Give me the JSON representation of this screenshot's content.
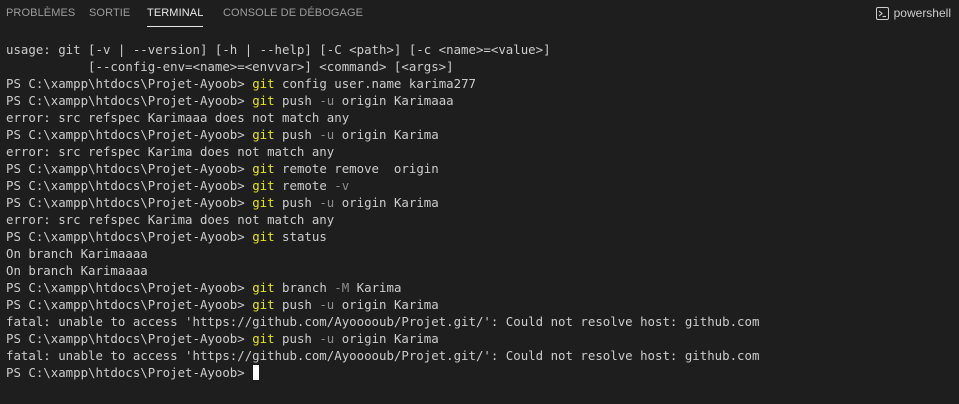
{
  "tabs": [
    {
      "label": "PROBLÈMES",
      "active": false
    },
    {
      "label": "SORTIE",
      "active": false
    },
    {
      "label": "TERMINAL",
      "active": true
    },
    {
      "label": "CONSOLE DE DÉBOGAGE",
      "active": false
    }
  ],
  "shell": {
    "label": "powershell",
    "icon": "terminal-powershell-icon"
  },
  "terminal": {
    "lines": [
      {
        "segments": [
          {
            "text": "usage: git [-v | --version] [-h | --help] [-C <path>] [-c <name>=<value>]",
            "style": "plain"
          }
        ]
      },
      {
        "segments": [
          {
            "text": "           [--config-env=<name>=<envvar>] <command> [<args>]",
            "style": "plain"
          }
        ]
      },
      {
        "segments": [
          {
            "text": "PS C:\\xampp\\htdocs\\Projet-Ayoob> ",
            "style": "plain"
          },
          {
            "text": "git",
            "style": "git"
          },
          {
            "text": " config user.name karima277",
            "style": "plain"
          }
        ]
      },
      {
        "segments": [
          {
            "text": "PS C:\\xampp\\htdocs\\Projet-Ayoob> ",
            "style": "plain"
          },
          {
            "text": "git",
            "style": "git"
          },
          {
            "text": " push ",
            "style": "plain"
          },
          {
            "text": "-u",
            "style": "dim"
          },
          {
            "text": " origin Karimaaa",
            "style": "plain"
          }
        ]
      },
      {
        "segments": [
          {
            "text": "error: src refspec Karimaaa does not match any",
            "style": "plain"
          }
        ]
      },
      {
        "segments": [
          {
            "text": "PS C:\\xampp\\htdocs\\Projet-Ayoob> ",
            "style": "plain"
          },
          {
            "text": "git",
            "style": "git"
          },
          {
            "text": " push ",
            "style": "plain"
          },
          {
            "text": "-u",
            "style": "dim"
          },
          {
            "text": " origin Karima",
            "style": "plain"
          }
        ]
      },
      {
        "segments": [
          {
            "text": "error: src refspec Karima does not match any",
            "style": "plain"
          }
        ]
      },
      {
        "segments": [
          {
            "text": "PS C:\\xampp\\htdocs\\Projet-Ayoob> ",
            "style": "plain"
          },
          {
            "text": "git",
            "style": "git"
          },
          {
            "text": " remote remove  origin",
            "style": "plain"
          }
        ]
      },
      {
        "segments": [
          {
            "text": "PS C:\\xampp\\htdocs\\Projet-Ayoob> ",
            "style": "plain"
          },
          {
            "text": "git",
            "style": "git"
          },
          {
            "text": " remote ",
            "style": "plain"
          },
          {
            "text": "-v",
            "style": "dim"
          }
        ]
      },
      {
        "segments": [
          {
            "text": "PS C:\\xampp\\htdocs\\Projet-Ayoob> ",
            "style": "plain"
          },
          {
            "text": "git",
            "style": "git"
          },
          {
            "text": " push ",
            "style": "plain"
          },
          {
            "text": "-u",
            "style": "dim"
          },
          {
            "text": " origin Karima",
            "style": "plain"
          }
        ]
      },
      {
        "segments": [
          {
            "text": "error: src refspec Karima does not match any",
            "style": "plain"
          }
        ]
      },
      {
        "segments": [
          {
            "text": "PS C:\\xampp\\htdocs\\Projet-Ayoob> ",
            "style": "plain"
          },
          {
            "text": "git",
            "style": "git"
          },
          {
            "text": " status",
            "style": "plain"
          }
        ]
      },
      {
        "segments": [
          {
            "text": "On branch Karimaaaa",
            "style": "plain"
          }
        ]
      },
      {
        "segments": [
          {
            "text": "On branch Karimaaaa",
            "style": "plain"
          }
        ]
      },
      {
        "segments": [
          {
            "text": "PS C:\\xampp\\htdocs\\Projet-Ayoob> ",
            "style": "plain"
          },
          {
            "text": "git",
            "style": "git"
          },
          {
            "text": " branch ",
            "style": "plain"
          },
          {
            "text": "-M",
            "style": "dim"
          },
          {
            "text": " Karima",
            "style": "plain"
          }
        ]
      },
      {
        "segments": [
          {
            "text": "PS C:\\xampp\\htdocs\\Projet-Ayoob> ",
            "style": "plain"
          },
          {
            "text": "git",
            "style": "git"
          },
          {
            "text": " push ",
            "style": "plain"
          },
          {
            "text": "-u",
            "style": "dim"
          },
          {
            "text": " origin Karima",
            "style": "plain"
          }
        ]
      },
      {
        "segments": [
          {
            "text": "fatal: unable to access 'https://github.com/Ayooooub/Projet.git/': Could not resolve host: github.com",
            "style": "plain"
          }
        ]
      },
      {
        "segments": [
          {
            "text": "PS C:\\xampp\\htdocs\\Projet-Ayoob> ",
            "style": "plain"
          },
          {
            "text": "git",
            "style": "git"
          },
          {
            "text": " push ",
            "style": "plain"
          },
          {
            "text": "-u",
            "style": "dim"
          },
          {
            "text": " origin Karima",
            "style": "plain"
          }
        ]
      },
      {
        "segments": [
          {
            "text": "fatal: unable to access 'https://github.com/Ayooooub/Projet.git/': Could not resolve host: github.com",
            "style": "plain"
          }
        ]
      },
      {
        "segments": [
          {
            "text": "PS C:\\xampp\\htdocs\\Projet-Ayoob> ",
            "style": "plain"
          }
        ],
        "cursor": true
      }
    ]
  },
  "colors": {
    "background": "#1e1e1e",
    "text": "#cccccc",
    "command": "#e5e510",
    "flag": "#8d8d8d",
    "active_tab": "#e7e7e7",
    "inactive_tab": "#9d9d9d"
  }
}
